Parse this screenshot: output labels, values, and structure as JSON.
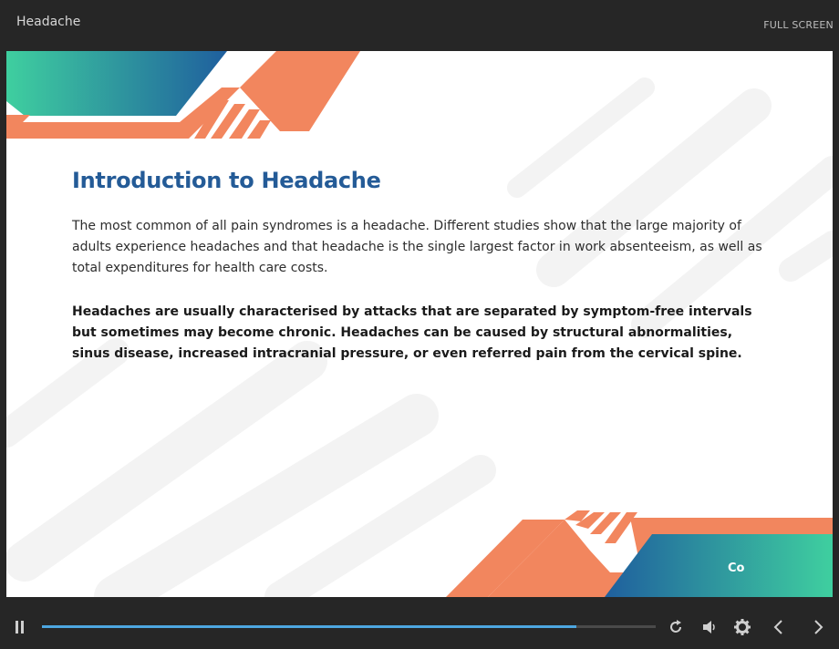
{
  "window": {
    "title": "Headache",
    "fullscreen_label": "FULL SCREEN"
  },
  "slide": {
    "heading": "Introduction to Headache",
    "paragraph1": "The most common of all pain syndromes is a headache. Different studies show that the large majority of adults experience headaches and that headache is the single largest factor in work absenteeism, as well as total expenditures for health care costs.",
    "paragraph2": "Headaches are usually characterised by attacks that are separated by symptom-free intervals but sometimes may become chronic. Headaches can be caused by structural abnormalities, sinus disease, increased intracranial pressure, or even referred pain from the cervical spine.",
    "continue_label": "Co"
  },
  "player": {
    "progress_fraction": 0.87,
    "icons": [
      "pause-icon",
      "replay-icon",
      "volume-icon",
      "gear-icon",
      "chevron-left-icon",
      "chevron-right-icon"
    ]
  },
  "colors": {
    "heading": "#245b97",
    "orange": "#f2865e",
    "teal": "#3fcf9f",
    "blue": "#1f5f9e",
    "progress": "#4da6e0",
    "chrome": "#262626"
  }
}
